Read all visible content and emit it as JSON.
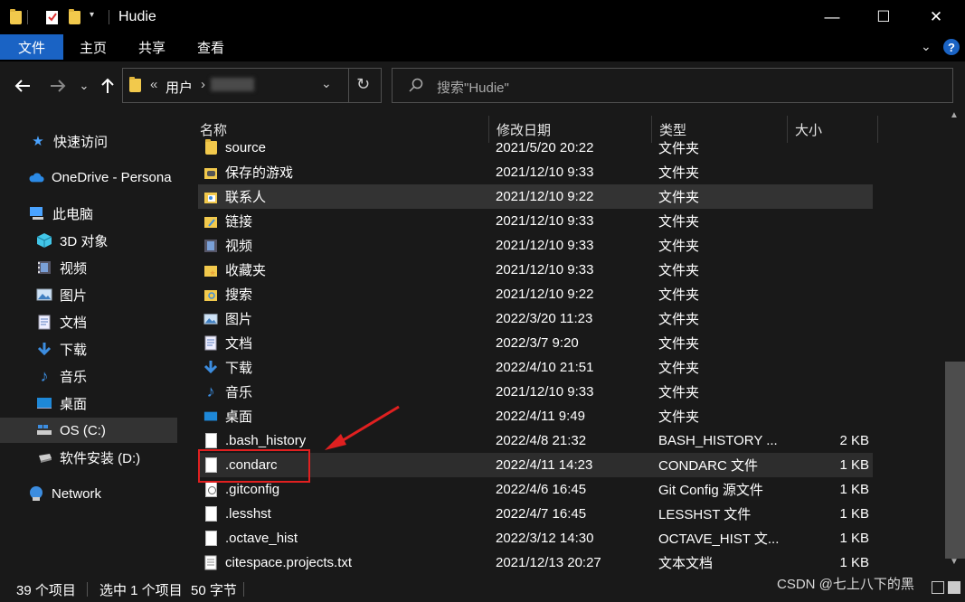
{
  "window": {
    "title": "Hudie",
    "controls": {
      "minimize": "—",
      "maximize": "☐",
      "close": "✕"
    }
  },
  "ribbon": {
    "tabs": [
      "文件",
      "主页",
      "共享",
      "查看"
    ],
    "help": "?"
  },
  "address": {
    "overflow": "«",
    "crumb1": "用户",
    "separator": "›",
    "search_placeholder": "搜索\"Hudie\""
  },
  "nav": {
    "items": [
      {
        "label": "快速访问",
        "icon": "star-icon"
      },
      {
        "label": "OneDrive - Persona",
        "icon": "cloud-icon"
      },
      {
        "label": "此电脑",
        "icon": "computer-icon"
      },
      {
        "label": "3D 对象",
        "icon": "cube-icon"
      },
      {
        "label": "视频",
        "icon": "video-icon"
      },
      {
        "label": "图片",
        "icon": "picture-icon"
      },
      {
        "label": "文档",
        "icon": "document-icon"
      },
      {
        "label": "下载",
        "icon": "download-icon"
      },
      {
        "label": "音乐",
        "icon": "music-icon"
      },
      {
        "label": "桌面",
        "icon": "desktop-icon"
      },
      {
        "label": "OS (C:)",
        "icon": "drive-icon"
      },
      {
        "label": "软件安装 (D:)",
        "icon": "drive-icon"
      },
      {
        "label": "Network",
        "icon": "network-icon"
      }
    ]
  },
  "columns": {
    "name": "名称",
    "date": "修改日期",
    "type": "类型",
    "size": "大小"
  },
  "files": [
    {
      "name": "source",
      "date": "2021/5/20 20:22",
      "type": "文件夹",
      "size": "",
      "icon": "folder-icon"
    },
    {
      "name": "保存的游戏",
      "date": "2021/12/10 9:33",
      "type": "文件夹",
      "size": "",
      "icon": "saved-games-icon"
    },
    {
      "name": "联系人",
      "date": "2021/12/10 9:22",
      "type": "文件夹",
      "size": "",
      "icon": "contacts-icon"
    },
    {
      "name": "链接",
      "date": "2021/12/10 9:33",
      "type": "文件夹",
      "size": "",
      "icon": "links-icon"
    },
    {
      "name": "视频",
      "date": "2021/12/10 9:33",
      "type": "文件夹",
      "size": "",
      "icon": "video-icon"
    },
    {
      "name": "收藏夹",
      "date": "2021/12/10 9:33",
      "type": "文件夹",
      "size": "",
      "icon": "favorites-icon"
    },
    {
      "name": "搜索",
      "date": "2021/12/10 9:22",
      "type": "文件夹",
      "size": "",
      "icon": "search-folder-icon"
    },
    {
      "name": "图片",
      "date": "2022/3/20 11:23",
      "type": "文件夹",
      "size": "",
      "icon": "picture-icon"
    },
    {
      "name": "文档",
      "date": "2022/3/7 9:20",
      "type": "文件夹",
      "size": "",
      "icon": "document-icon"
    },
    {
      "name": "下载",
      "date": "2022/4/10 21:51",
      "type": "文件夹",
      "size": "",
      "icon": "download-icon"
    },
    {
      "name": "音乐",
      "date": "2021/12/10 9:33",
      "type": "文件夹",
      "size": "",
      "icon": "music-icon"
    },
    {
      "name": "桌面",
      "date": "2022/4/11 9:49",
      "type": "文件夹",
      "size": "",
      "icon": "desktop-icon"
    },
    {
      "name": ".bash_history",
      "date": "2022/4/8 21:32",
      "type": "BASH_HISTORY ...",
      "size": "2 KB",
      "icon": "file-icon"
    },
    {
      "name": ".condarc",
      "date": "2022/4/11 14:23",
      "type": "CONDARC 文件",
      "size": "1 KB",
      "icon": "file-icon"
    },
    {
      "name": ".gitconfig",
      "date": "2022/4/6 16:45",
      "type": "Git Config 源文件",
      "size": "1 KB",
      "icon": "config-file-icon"
    },
    {
      "name": ".lesshst",
      "date": "2022/4/7 16:45",
      "type": "LESSHST 文件",
      "size": "1 KB",
      "icon": "file-icon"
    },
    {
      "name": ".octave_hist",
      "date": "2022/3/12 14:30",
      "type": "OCTAVE_HIST 文...",
      "size": "1 KB",
      "icon": "file-icon"
    },
    {
      "name": "citespace.projects.txt",
      "date": "2021/12/13 20:27",
      "type": "文本文档",
      "size": "1 KB",
      "icon": "text-file-icon"
    }
  ],
  "status": {
    "count": "39 个项目",
    "selected": "选中 1 个项目",
    "bytes": "50 字节"
  },
  "watermark": "CSDN @七上八下的黑"
}
